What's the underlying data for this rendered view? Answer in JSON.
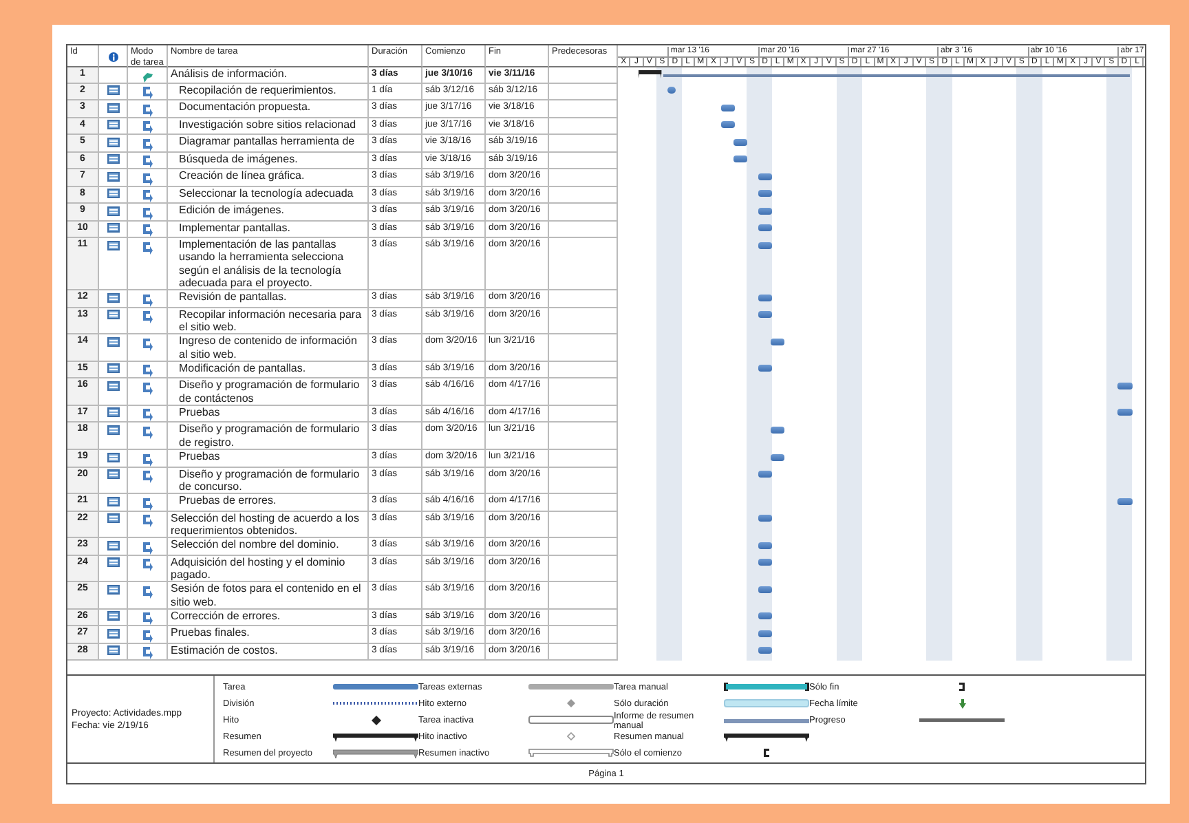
{
  "columns": {
    "id": "Id",
    "mode": "Modo de tarea",
    "name": "Nombre de tarea",
    "duration": "Duración",
    "start": "Comienzo",
    "finish": "Fin",
    "predecessors": "Predecesoras"
  },
  "timescale": {
    "weeks": [
      "mar 13 '16",
      "mar 20 '16",
      "mar 27 '16",
      "abr 3 '16",
      "abr 10 '16",
      "abr 17"
    ],
    "days": [
      "X",
      "J",
      "V",
      "S",
      "D",
      "L",
      "M",
      "X",
      "J",
      "V",
      "S",
      "D",
      "L",
      "M",
      "X",
      "J",
      "V",
      "S",
      "D",
      "L",
      "M",
      "X",
      "J",
      "V",
      "S",
      "D",
      "L",
      "M",
      "X",
      "J",
      "V",
      "S",
      "D",
      "L",
      "M",
      "X",
      "J",
      "V",
      "S",
      "D",
      "L"
    ]
  },
  "tasks": [
    {
      "id": "1",
      "kind": "summary",
      "name": "Análisis de información.",
      "duration": "3 días",
      "start": "jue 3/10/16",
      "finish": "vie 3/11/16",
      "children": [
        {
          "id": "2",
          "kind": "task",
          "name": "Recopilación de requerimientos.",
          "duration": "1 día",
          "start": "sáb 3/12/16",
          "finish": "sáb 3/12/16"
        },
        {
          "id": "3",
          "kind": "task",
          "name": "Documentación propuesta.",
          "duration": "3 días",
          "start": "jue 3/17/16",
          "finish": "vie 3/18/16"
        },
        {
          "id": "4",
          "kind": "task",
          "name": "Investigación sobre sitios relacionad",
          "duration": "3 días",
          "start": "jue 3/17/16",
          "finish": "vie 3/18/16"
        },
        {
          "id": "5",
          "kind": "task",
          "name": "Diagramar pantallas herramienta de",
          "duration": "3 días",
          "start": "vie 3/18/16",
          "finish": "sáb 3/19/16"
        },
        {
          "id": "6",
          "kind": "task",
          "name": "Búsqueda de imágenes.",
          "duration": "3 días",
          "start": "vie 3/18/16",
          "finish": "sáb 3/19/16"
        },
        {
          "id": "7",
          "kind": "task",
          "name": "Creación de línea gráfica.",
          "duration": "3 días",
          "start": "sáb 3/19/16",
          "finish": "dom 3/20/16"
        },
        {
          "id": "8",
          "kind": "task",
          "name": "Seleccionar la tecnología adecuada",
          "duration": "3 días",
          "start": "sáb 3/19/16",
          "finish": "dom 3/20/16"
        },
        {
          "id": "9",
          "kind": "task",
          "name": "Edición de imágenes.",
          "duration": "3 días",
          "start": "sáb 3/19/16",
          "finish": "dom 3/20/16"
        },
        {
          "id": "10",
          "kind": "task",
          "name": "Implementar pantallas.",
          "duration": "3 días",
          "start": "sáb 3/19/16",
          "finish": "dom 3/20/16"
        },
        {
          "id": "11",
          "kind": "task",
          "name": "Implementación de las pantallas usando la herramienta selecciona según el análisis de la tecnología adecuada para el proyecto.",
          "duration": "3 días",
          "start": "sáb 3/19/16",
          "finish": "dom 3/20/16"
        },
        {
          "id": "12",
          "kind": "task",
          "name": "Revisión de pantallas.",
          "duration": "3 días",
          "start": "sáb 3/19/16",
          "finish": "dom 3/20/16"
        },
        {
          "id": "13",
          "kind": "task",
          "name": "Recopilar información necesaria para el sitio web.",
          "duration": "3 días",
          "start": "sáb 3/19/16",
          "finish": "dom 3/20/16"
        },
        {
          "id": "14",
          "kind": "task",
          "name": "Ingreso de contenido de información al sitio web.",
          "duration": "3 días",
          "start": "dom 3/20/16",
          "finish": "lun 3/21/16"
        },
        {
          "id": "15",
          "kind": "task",
          "name": "Modificación de pantallas.",
          "duration": "3 días",
          "start": "sáb 3/19/16",
          "finish": "dom 3/20/16"
        },
        {
          "id": "16",
          "kind": "task",
          "name": "Diseño y programación de formulario de contáctenos",
          "duration": "3 días",
          "start": "sáb 4/16/16",
          "finish": "dom 4/17/16"
        },
        {
          "id": "17",
          "kind": "task",
          "name": "Pruebas",
          "duration": "3 días",
          "start": "sáb 4/16/16",
          "finish": "dom 4/17/16"
        },
        {
          "id": "18",
          "kind": "task",
          "name": "Diseño y programación de formulario de registro.",
          "duration": "3 días",
          "start": "dom 3/20/16",
          "finish": "lun 3/21/16"
        },
        {
          "id": "19",
          "kind": "task",
          "name": "Pruebas",
          "duration": "3 días",
          "start": "dom 3/20/16",
          "finish": "lun 3/21/16"
        },
        {
          "id": "20",
          "kind": "task",
          "name": "Diseño y programación de formulario de concurso.",
          "duration": "3 días",
          "start": "sáb 3/19/16",
          "finish": "dom 3/20/16"
        },
        {
          "id": "21",
          "kind": "task",
          "name": "Pruebas de errores.",
          "duration": "3 días",
          "start": "sáb 4/16/16",
          "finish": "dom 4/17/16"
        }
      ]
    },
    {
      "id": "22",
      "kind": "task",
      "name": "Selección del hosting de acuerdo a los requerimientos obtenidos.",
      "duration": "3 días",
      "start": "sáb 3/19/16",
      "finish": "dom 3/20/16"
    },
    {
      "id": "23",
      "kind": "task",
      "name": "Selección del nombre del dominio.",
      "duration": "3 días",
      "start": "sáb 3/19/16",
      "finish": "dom 3/20/16"
    },
    {
      "id": "24",
      "kind": "task",
      "name": "Adquisición del hosting y el dominio pagado.",
      "duration": "3 días",
      "start": "sáb 3/19/16",
      "finish": "dom 3/20/16"
    },
    {
      "id": "25",
      "kind": "task",
      "name": "Sesión de fotos para el contenido en el sitio web.",
      "duration": "3 días",
      "start": "sáb 3/19/16",
      "finish": "dom 3/20/16"
    },
    {
      "id": "26",
      "kind": "task",
      "name": "Corrección de errores.",
      "duration": "3 días",
      "start": "sáb 3/19/16",
      "finish": "dom 3/20/16"
    },
    {
      "id": "27",
      "kind": "task",
      "name": "Pruebas finales.",
      "duration": "3 días",
      "start": "sáb 3/19/16",
      "finish": "dom 3/20/16"
    },
    {
      "id": "28",
      "kind": "task",
      "name": "Estimación de costos.",
      "duration": "3 días",
      "start": "sáb 3/19/16",
      "finish": "dom 3/20/16"
    }
  ],
  "legend": {
    "project": "Proyecto: Actividades.mpp",
    "date": "Fecha: vie 2/19/16",
    "items": [
      {
        "label": "Tarea",
        "kind": "task"
      },
      {
        "label": "División",
        "kind": "split"
      },
      {
        "label": "Hito",
        "kind": "milestone"
      },
      {
        "label": "Resumen",
        "kind": "summary"
      },
      {
        "label": "Resumen del proyecto",
        "kind": "project-summary"
      },
      {
        "label": "Tareas externas",
        "kind": "external"
      },
      {
        "label": "Hito externo",
        "kind": "external-milestone"
      },
      {
        "label": "Tarea inactiva",
        "kind": "inactive-task"
      },
      {
        "label": "Hito inactivo",
        "kind": "inactive-milestone"
      },
      {
        "label": "Resumen inactivo",
        "kind": "inactive-summary"
      },
      {
        "label": "Tarea manual",
        "kind": "manual-task"
      },
      {
        "label": "Sólo duración",
        "kind": "duration-only"
      },
      {
        "label": "Informe de resumen manual",
        "kind": "manual-rollup"
      },
      {
        "label": "Resumen manual",
        "kind": "manual-summary"
      },
      {
        "label": "Sólo el comienzo",
        "kind": "start-only"
      },
      {
        "label": "Sólo fin",
        "kind": "finish-only"
      },
      {
        "label": "Fecha límite",
        "kind": "deadline"
      },
      {
        "label": "Progreso",
        "kind": "progress"
      }
    ]
  },
  "footer": "Página 1"
}
